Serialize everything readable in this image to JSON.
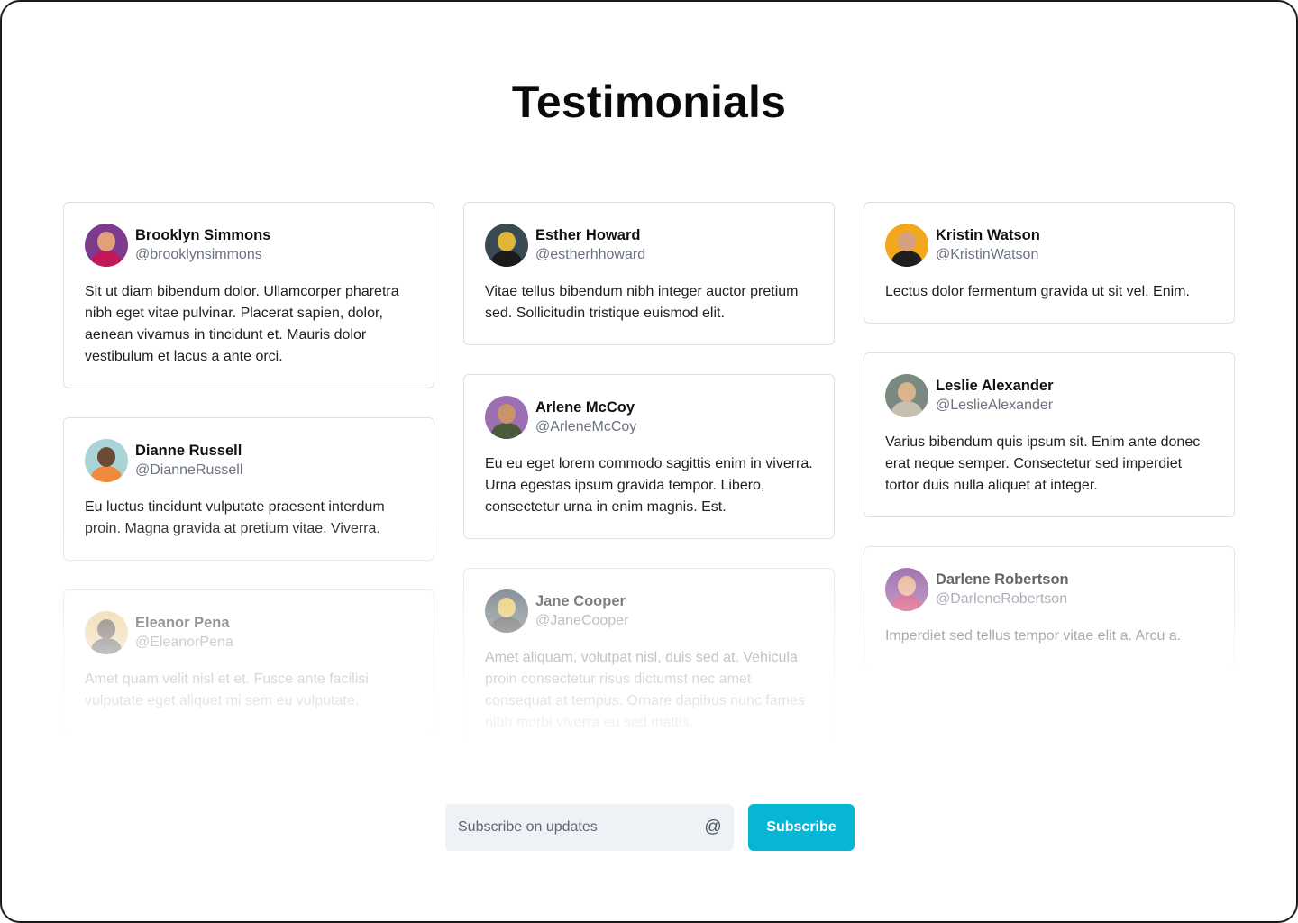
{
  "page": {
    "title": "Testimonials"
  },
  "columns": [
    [
      {
        "name": "Brooklyn Simmons",
        "handle": "@brooklynsimmons",
        "text": "Sit ut diam bibendum dolor. Ullamcorper pharetra nibh eget vitae pulvinar. Placerat sapien, dolor, aenean vivamus in tincidunt et. Mauris dolor vestibulum et lacus a ante orci.",
        "avatar_bg": "#7e3b8e",
        "avatar_face": "#e2a07a",
        "avatar_body": "#c2185b"
      },
      {
        "name": "Dianne Russell",
        "handle": "@DianneRussell",
        "text": "Eu luctus tincidunt vulputate praesent interdum proin. Magna gravida at pretium vitae. Viverra.",
        "avatar_bg": "#a8d4d6",
        "avatar_face": "#6d4a36",
        "avatar_body": "#f08a3c"
      },
      {
        "name": "Eleanor Pena",
        "handle": "@EleanorPena",
        "text": "Amet quam velit nisl et et. Fusce ante facilisi vulputate eget aliquet mi sem eu vulputate.",
        "avatar_bg": "#e8c37a",
        "avatar_face": "#3a2a22",
        "avatar_body": "#2b2b2b"
      }
    ],
    [
      {
        "name": "Esther Howard",
        "handle": "@estherhhoward",
        "text": "Vitae tellus bibendum nibh integer auctor pretium sed. Sollicitudin tristique euismod elit.",
        "avatar_bg": "#3a4a52",
        "avatar_face": "#e0b63a",
        "avatar_body": "#1b1b1b"
      },
      {
        "name": "Arlene McCoy",
        "handle": "@ArleneMcCoy",
        "text": "Eu eu eget lorem commodo sagittis enim in viverra. Urna egestas ipsum gravida tempor. Libero, consectetur urna in enim magnis. Est.",
        "avatar_bg": "#9c6fb3",
        "avatar_face": "#c9936b",
        "avatar_body": "#4a5a3a"
      },
      {
        "name": "Jane Cooper",
        "handle": "@JaneCooper",
        "text": "Amet aliquam, volutpat nisl, duis sed at. Vehicula proin consectetur risus dictumst nec amet consequat at tempus. Ornare dapibus nunc fames nibh morbi viverra eu sed mattis.",
        "avatar_bg": "#3a4a52",
        "avatar_face": "#e0b63a",
        "avatar_body": "#1b1b1b"
      }
    ],
    [
      {
        "name": "Kristin Watson",
        "handle": "@KristinWatson",
        "text": "Lectus dolor fermentum gravida ut sit vel. Enim.",
        "avatar_bg": "#f2a81d",
        "avatar_face": "#d6a080",
        "avatar_body": "#1f1f1f"
      },
      {
        "name": "Leslie Alexander",
        "handle": "@LeslieAlexander",
        "text": "Varius bibendum quis ipsum sit. Enim ante donec erat neque semper. Consectetur sed imperdiet tortor duis nulla aliquet at integer.",
        "avatar_bg": "#7a8a80",
        "avatar_face": "#d9b48c",
        "avatar_body": "#c7c0b0"
      },
      {
        "name": "Darlene Robertson",
        "handle": "@DarleneRobertson",
        "text": "Imperdiet sed tellus tempor vitae elit a. Arcu a.",
        "avatar_bg": "#7e3b8e",
        "avatar_face": "#e2a07a",
        "avatar_body": "#c2185b"
      }
    ]
  ],
  "subscribe": {
    "placeholder": "Subscribe on updates",
    "icon": "at-icon",
    "icon_glyph": "@",
    "button_label": "Subscribe",
    "accent": "#06b6d4"
  }
}
